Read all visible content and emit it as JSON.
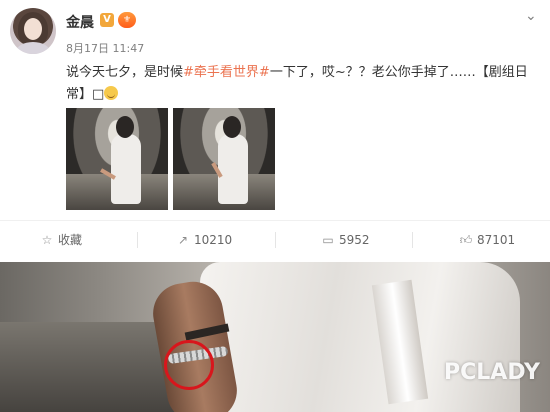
{
  "post": {
    "username": "金晨",
    "verified_badge": "V",
    "time": "8月17日 11:47",
    "more_glyph": "⌄",
    "text": {
      "before_topic1": "说今天七夕，是时候",
      "topic1": "#牵手看世界#",
      "after_topic1": "一下了，哎~？？老公你手掉了……【剧组日常】",
      "after_topic1_tail": "□"
    }
  },
  "actions": {
    "favorite": {
      "icon": "star-icon",
      "label": "收藏"
    },
    "repost": {
      "icon": "repost-icon",
      "count": "10210"
    },
    "comment": {
      "icon": "comment-icon",
      "count": "5952"
    },
    "like": {
      "icon": "thumbs-up-icon",
      "count": "87101"
    }
  },
  "photo": {
    "watermark": "PCLADY",
    "highlight_color": "#d8161c"
  },
  "colors": {
    "topic": "#eb7350",
    "meta": "#808080",
    "badge": "#f2a73b"
  }
}
